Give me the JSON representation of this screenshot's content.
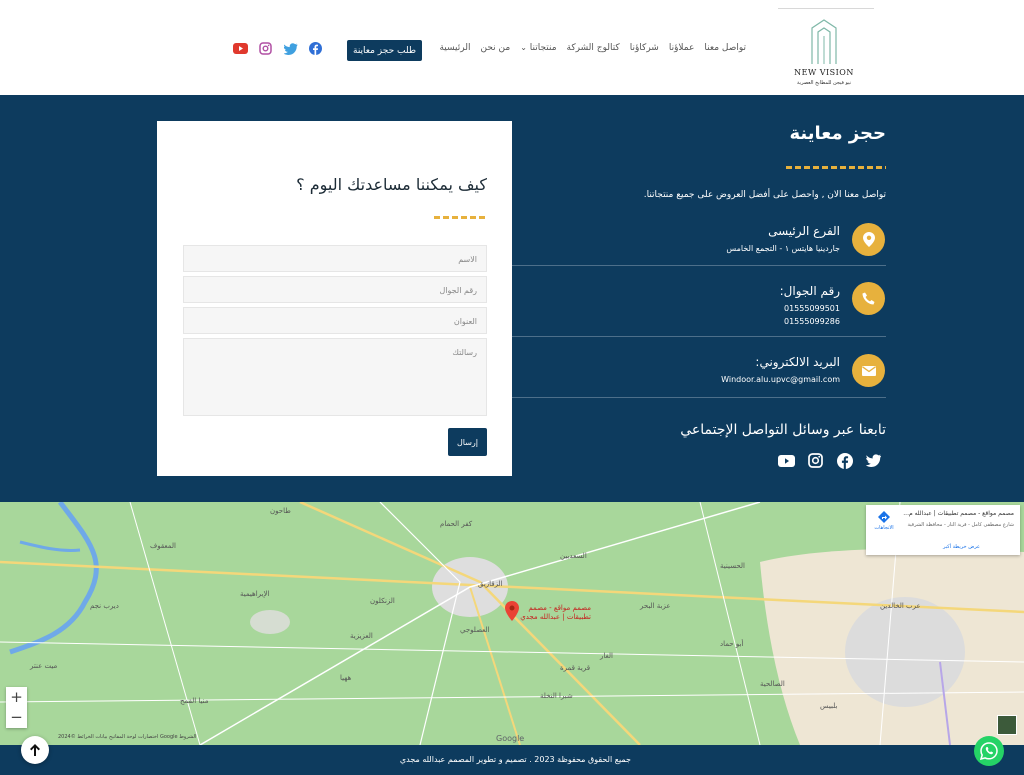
{
  "header": {
    "logo": {
      "brand": "NEW VISION",
      "tagline": "نيو فيجن للمطابخ العصرية"
    },
    "nav": [
      {
        "label": "الرئيسية"
      },
      {
        "label": "من نحن"
      },
      {
        "label": "منتجاتنا",
        "has_dropdown": true
      },
      {
        "label": "كتالوج الشركة"
      },
      {
        "label": "شركاؤنا"
      },
      {
        "label": "عملاؤنا"
      },
      {
        "label": "تواصل معنا"
      }
    ],
    "cta_label": "طلب حجز معاينة",
    "socials": [
      "facebook-icon",
      "twitter-icon",
      "instagram-icon",
      "youtube-icon"
    ]
  },
  "form": {
    "title": "كيف يمكننا مساعدتك اليوم ؟",
    "name_placeholder": "الاسم",
    "phone_placeholder": "رقم الجوال",
    "address_placeholder": "العنوان",
    "message_placeholder": "رسالتك",
    "submit_label": "إرسال"
  },
  "info": {
    "title": "حجز معاينة",
    "intro": "تواصل معنا الان , واحصل على أفضل العروض على جميع منتجاتنا.",
    "branch_heading": "الفرع الرئيسى",
    "branch_address": "جاردينيا هايتس ١ - التجمع الخامس",
    "phone_heading": "رقم الجوال:",
    "phone_1": "01555099501",
    "phone_2": "01555099286",
    "email_heading": "البريد الالكتروني:",
    "email": "Windoor.alu.upvc@gmail.com",
    "follow_title": "تابعنا عبر وسائل التواصل الإجتماعي"
  },
  "map": {
    "card_title": "مصمم مواقع - مصمم تطبيقات | عبدالله م...",
    "card_address": "شارع مصطفى كامل - قرية النار - محافظة الشرقية",
    "card_link": "عرض خريطة أكبر",
    "card_directions": "الاتجاهات",
    "pin_label_1": "مصمم مواقع - مصمم",
    "pin_label_2": "تطبيقات | عبدالله مجدي",
    "zoom_in": "+",
    "zoom_out": "−",
    "credit": "اختصارات لوحة المفاتيح  بيانات الخرائط ©2024 Google  الشروط",
    "google": "Google",
    "labels": [
      "الزقازيق",
      "كفر الحمام",
      "المعقوف",
      "العصلوجي",
      "ههيا",
      "عرب الخالدين",
      "السعديين",
      "الإبراهيمية",
      "ديرب نجم",
      "الحسينية",
      "طاحون",
      "عزبة البحر",
      "ميت عنتر",
      "شبرا النخلة",
      "منيا القمح",
      "العزيزية",
      "بلبيس",
      "الزنكلون",
      "الغار",
      "أبو حماد",
      "قرية قمرة",
      "الصالحية"
    ]
  },
  "footer": {
    "copyright": "جميع الحقوق محفوظة 2023 . تصميم و تطوير المصمم عبدالله مجدي"
  }
}
